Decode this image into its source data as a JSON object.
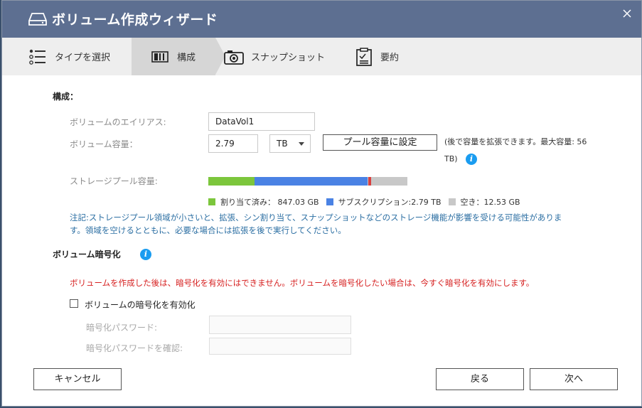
{
  "window": {
    "title": "ボリューム作成ウィザード"
  },
  "steps": [
    {
      "label": "タイプを選択",
      "icon": "list-icon",
      "active": false
    },
    {
      "label": "構成",
      "icon": "disk-stack-icon",
      "active": true
    },
    {
      "label": "スナップショット",
      "icon": "camera-icon",
      "active": false
    },
    {
      "label": "要約",
      "icon": "clipboard-icon",
      "active": false
    }
  ],
  "config": {
    "section_title": "構成：",
    "alias_label": "ボリュームのエイリアス:",
    "alias_value": "DataVol1",
    "capacity_label": "ボリューム容量：",
    "capacity_value": "2.79",
    "unit_selected": "TB",
    "set_pool_button": "プール容量に設定",
    "hint_line1": "(後で容量を拡張できます。最大容量: 56",
    "hint_line2": "TB)",
    "pool_label": "ストレージプール容量:",
    "pool_bar": {
      "allocated_fraction": 0.232,
      "subscription_fraction": 0.568,
      "free_fraction": 0.2,
      "marker_position_fraction": 0.805
    },
    "legend": [
      {
        "label": "割り当て済み： 847.03 GB",
        "color": "#7cc63c"
      },
      {
        "label": "サブスクリプション:2.79 TB",
        "color": "#4a82e4"
      },
      {
        "label": "空き：12.53 GB",
        "color": "#c8c8c8"
      }
    ],
    "note_line1": "注記:ストレージプール領域が小さいと、拡張、シン割り当て、スナップショットなどのストレージ機能が影響を受ける可能性がありま",
    "note_line2": "す。領域を空けるとともに、必要な場合には拡張を後で実行してください。"
  },
  "encryption": {
    "section_title": "ボリューム暗号化",
    "warning": "ボリュームを作成した後は、暗号化を有効にはできません。ボリュームを暗号化したい場合は、今すぐ暗号化を有効にします。",
    "enable_label": "ボリュームの暗号化を有効化",
    "enabled": false,
    "password_label": "暗号化パスワード:",
    "confirm_label": "暗号化パスワードを確認:"
  },
  "footer": {
    "cancel": "キャンセル",
    "back": "戻る",
    "next": "次へ"
  },
  "colors": {
    "titlebar": "#5d6f91",
    "note": "#2c6fa3",
    "warning": "#d62020",
    "info": "#1a9cf0"
  }
}
